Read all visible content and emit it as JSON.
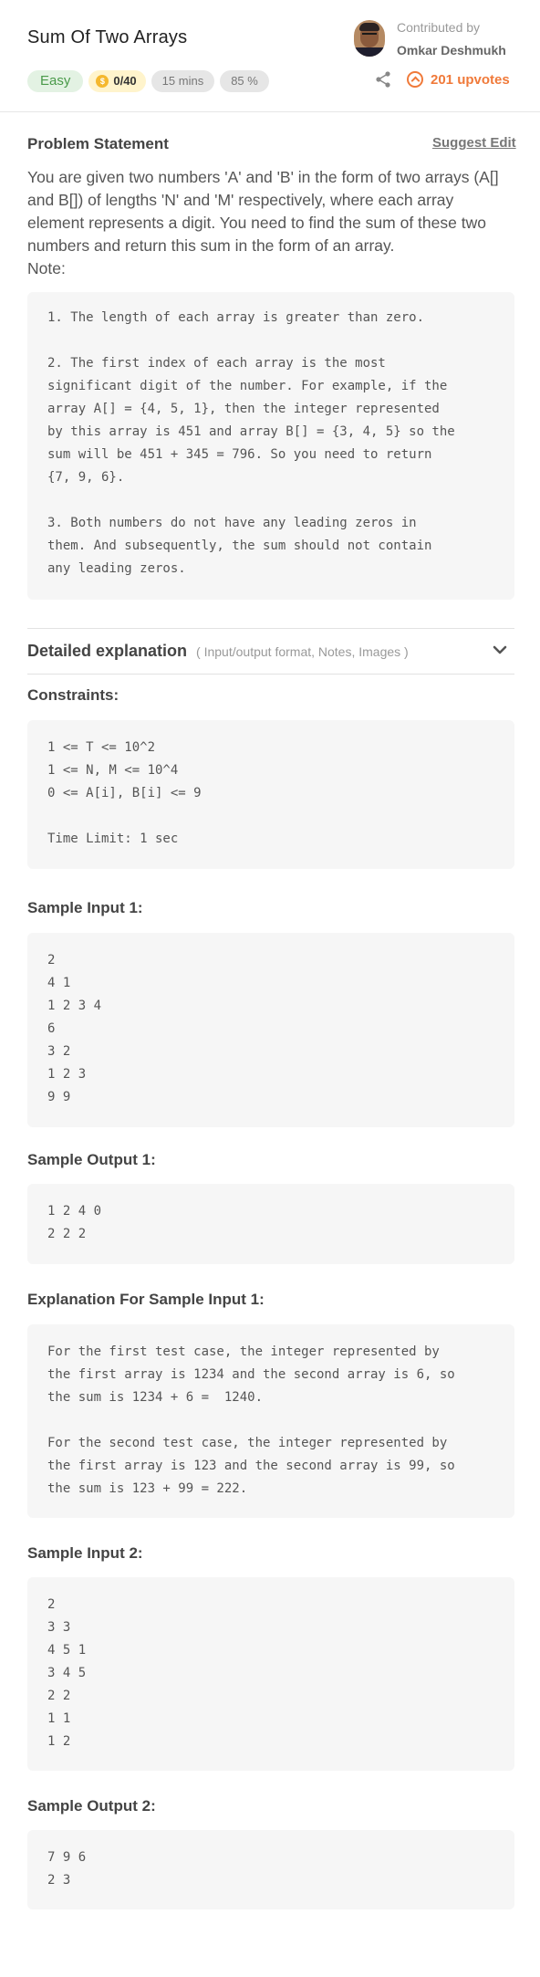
{
  "problem": {
    "title": "Sum Of Two Arrays",
    "difficulty": "Easy",
    "coins": "0/40",
    "time": "15 mins",
    "success": "85 %",
    "contributor_label": "Contributed by",
    "contributor_name": "Omkar Deshmukh",
    "upvotes": "201 upvotes"
  },
  "statement": {
    "heading": "Problem Statement",
    "suggest_edit": "Suggest Edit",
    "text": "You are given two numbers 'A' and 'B' in the form of two arrays (A[] and B[]) of lengths 'N' and 'M' respectively, where each array element represents a digit. You need to find the sum of these two numbers and return this sum in the form of an array.",
    "note_label": "Note:",
    "notes": "1. The length of each array is greater than zero.\n\n2. The first index of each array is the most\nsignificant digit of the number. For example, if the\narray A[] = {4, 5, 1}, then the integer represented\nby this array is 451 and array B[] = {3, 4, 5} so the\nsum will be 451 + 345 = 796. So you need to return\n{7, 9, 6}.\n\n3. Both numbers do not have any leading zeros in\nthem. And subsequently, the sum should not contain\nany leading zeros."
  },
  "detailed": {
    "label": "Detailed explanation",
    "hint": "( Input/output format, Notes, Images )"
  },
  "sections": {
    "constraints_title": "Constraints:",
    "constraints": "1 <= T <= 10^2\n1 <= N, M <= 10^4\n0 <= A[i], B[i] <= 9\n\nTime Limit: 1 sec",
    "sample_input_1_title": "Sample Input 1:",
    "sample_input_1": "2\n4 1\n1 2 3 4\n6\n3 2\n1 2 3\n9 9",
    "sample_output_1_title": "Sample Output 1:",
    "sample_output_1": "1 2 4 0\n2 2 2",
    "explanation_1_title": "Explanation For Sample Input 1:",
    "explanation_1": "For the first test case, the integer represented by\nthe first array is 1234 and the second array is 6, so\nthe sum is 1234 + 6 =  1240.\n\nFor the second test case, the integer represented by\nthe first array is 123 and the second array is 99, so\nthe sum is 123 + 99 = 222.",
    "sample_input_2_title": "Sample Input 2:",
    "sample_input_2": "2\n3 3\n4 5 1\n3 4 5\n2 2\n1 1\n1 2",
    "sample_output_2_title": "Sample Output 2:",
    "sample_output_2": "7 9 6\n2 3"
  },
  "colors": {
    "accent": "#f07a3a",
    "easy_bg": "#e3f2e3",
    "easy_text": "#4a9a4a",
    "coin": "#f5b82e"
  },
  "icons": [
    "coin-icon",
    "share-icon",
    "upvote-icon",
    "chevron-down-icon"
  ]
}
